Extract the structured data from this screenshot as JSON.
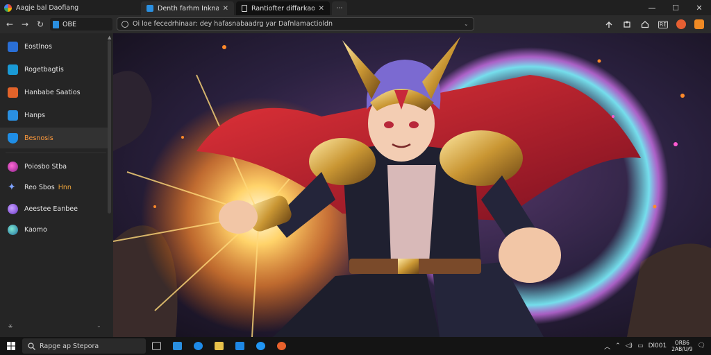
{
  "window": {
    "app_title": "Aagje bal Daofiang",
    "controls": {
      "minimize": "—",
      "maximize": "☐",
      "close": "✕"
    }
  },
  "tabs": [
    {
      "label": "Denth farhm Inknabeols",
      "close": "✕",
      "active": false
    },
    {
      "label": "Rantiofter diffarkaor",
      "close": "✕",
      "active": true
    },
    {
      "label": "···",
      "active": false
    }
  ],
  "toolbar": {
    "back": "←",
    "forward": "→",
    "reload": "↻",
    "profile_chip": "OBE",
    "url": "Oi loe fecedrhinaar: dey hafasnabaadrg yar Dafnlamactioldn",
    "url_dropdown": "⌄"
  },
  "sidebar": {
    "items": [
      {
        "label": "Eostlnos",
        "icon": "tools-icon",
        "color": "#2a6fd6"
      },
      {
        "label": "Rogetbagtis",
        "icon": "bookmark-icon",
        "color": "#1a9ad6"
      },
      {
        "label": "Hanbabe Saatios",
        "icon": "grid-icon",
        "color": "#e2632a"
      },
      {
        "label": "Hanps",
        "icon": "page-icon",
        "color": "#2a8fe0"
      },
      {
        "label": "Besnosis",
        "icon": "shield-icon",
        "color": "#1f8ee6",
        "active": true
      },
      {
        "label": "Poiosbo Stba",
        "icon": "orb-icon",
        "color": "#c238b8"
      },
      {
        "label": "Reo Sbos",
        "icon": "spark-icon",
        "color": "#5a7ee6",
        "badge": "Hnn",
        "badge_color": "#f0a63c"
      },
      {
        "label": "Aeestee Eanbee",
        "icon": "planet-icon",
        "color": "#9b5de5"
      },
      {
        "label": "Kaomo",
        "icon": "globe-icon",
        "color": "#2bb5a0"
      }
    ],
    "footer_left": "⚹",
    "footer_right": "⌄"
  },
  "taskbar": {
    "search_placeholder": "Rapge ap Stepora",
    "apps": [
      {
        "name": "task-view-icon",
        "color": "#bdbdbd"
      },
      {
        "name": "store-app-icon",
        "color": "#2a8fe0"
      },
      {
        "name": "edge-app-icon",
        "color": "#1e8be8"
      },
      {
        "name": "folder-app-icon",
        "color": "#e8c24a"
      },
      {
        "name": "mail-app-icon",
        "color": "#1e88e5"
      },
      {
        "name": "browser-app-icon",
        "color": "#2196f3"
      },
      {
        "name": "record-app-icon",
        "color": "#e8612c"
      }
    ],
    "tray_time": "Dl001",
    "tray_line1": "ORB6",
    "tray_line2": "2AB/U/9"
  }
}
